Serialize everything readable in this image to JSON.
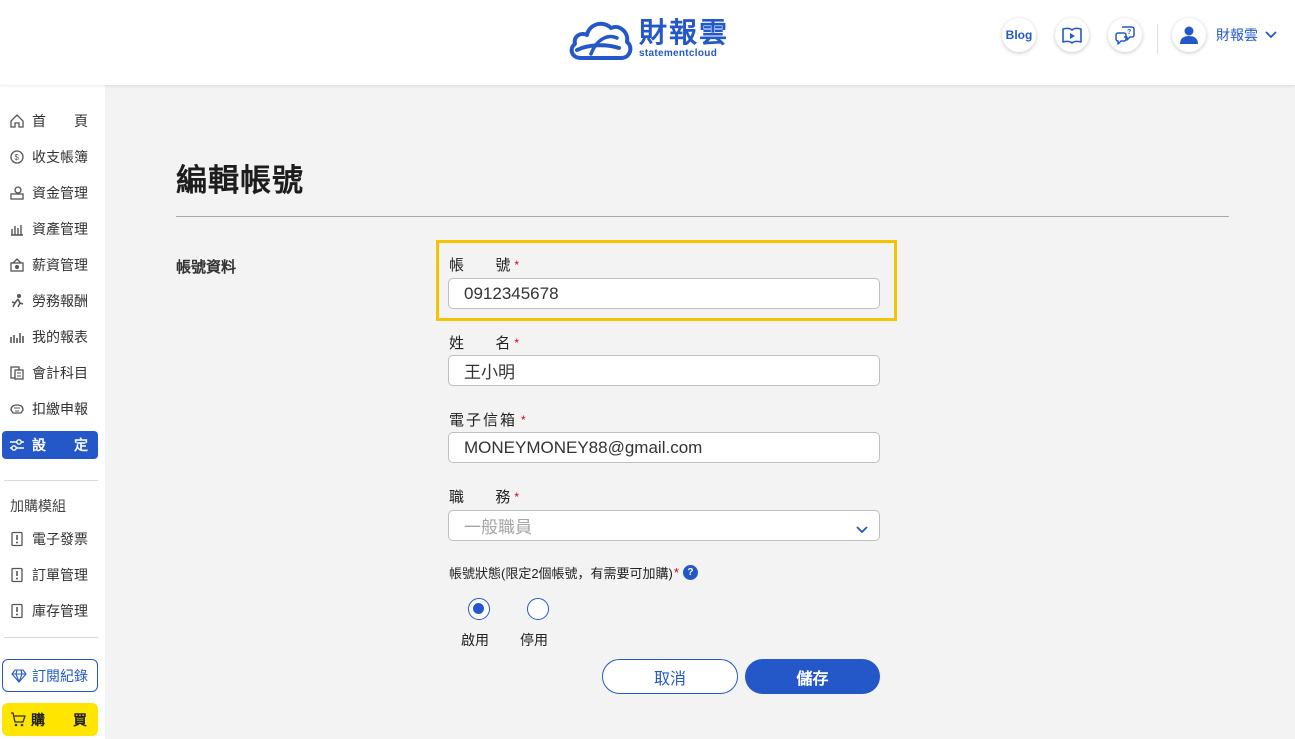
{
  "header": {
    "logo_cn": "財報雲",
    "logo_en": "statementcloud",
    "blog_label": "Blog",
    "user_name": "財報雲",
    "accent_color": "#2458c9"
  },
  "sidebar": {
    "items": [
      {
        "label": "首　　頁",
        "icon": "home-icon"
      },
      {
        "label": "收支帳簿",
        "icon": "coin-icon"
      },
      {
        "label": "資金管理",
        "icon": "fund-icon"
      },
      {
        "label": "資產管理",
        "icon": "assets-icon"
      },
      {
        "label": "薪資管理",
        "icon": "salary-icon"
      },
      {
        "label": "勞務報酬",
        "icon": "labor-icon"
      },
      {
        "label": "我的報表",
        "icon": "chart-icon"
      },
      {
        "label": "會計科目",
        "icon": "ledger-icon"
      },
      {
        "label": "扣繳申報",
        "icon": "tax-icon"
      },
      {
        "label": "設　　定",
        "icon": "settings-icon",
        "active": true
      }
    ],
    "addon_section": "加購模組",
    "addons": [
      {
        "label": "電子發票",
        "icon": "invoice-icon"
      },
      {
        "label": "訂單管理",
        "icon": "order-icon"
      },
      {
        "label": "庫存管理",
        "icon": "inventory-icon"
      }
    ],
    "subscription_label": "訂閱紀錄",
    "buy_label": "購　　買"
  },
  "main": {
    "page_title": "編輯帳號",
    "section_title": "帳號資料",
    "fields": {
      "account": {
        "label_a": "帳",
        "label_b": "號",
        "value": "0912345678"
      },
      "name": {
        "label_a": "姓",
        "label_b": "名",
        "value": "王小明"
      },
      "email": {
        "label": "電子信箱",
        "value": "MONEYMONEY88@gmail.com"
      },
      "role": {
        "label_a": "職",
        "label_b": "務",
        "value": "一般職員"
      }
    },
    "required_mark": "*",
    "status_label": "帳號狀態(限定2個帳號，有需要可加購)",
    "status_options": [
      {
        "label": "啟用",
        "checked": true
      },
      {
        "label": "停用",
        "checked": false
      }
    ],
    "cancel_label": "取消",
    "save_label": "儲存"
  }
}
